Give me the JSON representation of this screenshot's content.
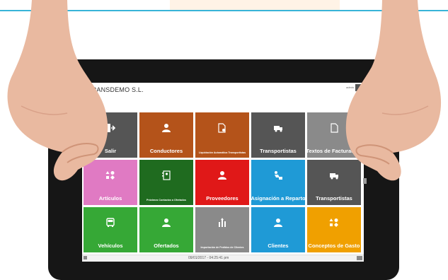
{
  "app": {
    "title": "TRANSDEMO S.L.",
    "user": "admin",
    "user_sub": "S.S"
  },
  "tiles": [
    {
      "label": "Salir",
      "color": "#555555",
      "icon": "exit-icon",
      "small": false
    },
    {
      "label": "Conductores",
      "color": "#b4531a",
      "icon": "person-icon",
      "small": false
    },
    {
      "label": "Liquidación Automática Transportistas",
      "color": "#b4531a",
      "icon": "document-gear-icon",
      "small": true
    },
    {
      "label": "Transportistas",
      "color": "#555555",
      "icon": "truck-icon",
      "small": false
    },
    {
      "label": "Textos de Facturación",
      "color": "#8a8a8a",
      "icon": "document-icon",
      "small": false
    },
    {
      "label": "Artículos",
      "color": "#e07ac3",
      "icon": "shapes-icon",
      "small": false
    },
    {
      "label": "Próximos Contactos a Ofertados",
      "color": "#1f6b1f",
      "icon": "contacts-icon",
      "small": true
    },
    {
      "label": "Proveedores",
      "color": "#e01818",
      "icon": "person-icon",
      "small": false
    },
    {
      "label": "Asignación a Reparto",
      "color": "#1f9ad6",
      "icon": "delivery-icon",
      "small": false
    },
    {
      "label": "Transportistas",
      "color": "#555555",
      "icon": "truck-icon",
      "small": false
    },
    {
      "label": "Vehículos",
      "color": "#36a836",
      "icon": "bus-icon",
      "small": false
    },
    {
      "label": "Ofertados",
      "color": "#36a836",
      "icon": "person-icon",
      "small": false
    },
    {
      "label": "Importación de Pedidos de Clientes",
      "color": "#8a8a8a",
      "icon": "import-icon",
      "small": true
    },
    {
      "label": "Clientes",
      "color": "#1f9ad6",
      "icon": "person-icon",
      "small": false
    },
    {
      "label": "Conceptos de Gasto",
      "color": "#f0a000",
      "icon": "shapes-icon",
      "small": false
    }
  ],
  "footer": {
    "datetime": "09/01/2017 - 04:25:41 pm"
  }
}
